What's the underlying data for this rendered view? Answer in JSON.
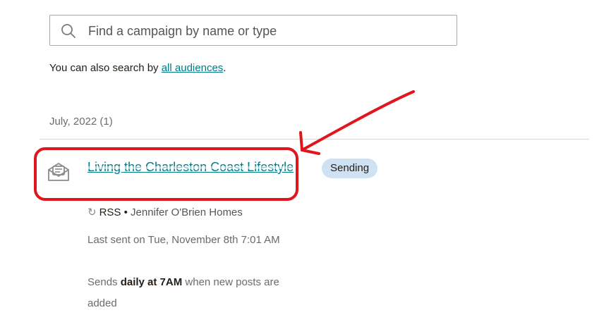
{
  "search": {
    "placeholder": "Find a campaign by name or type",
    "icon": "search-icon"
  },
  "helper": {
    "prefix": "You can also search by ",
    "link": "all audiences",
    "suffix": "."
  },
  "group": {
    "month_label": "July, 2022 (1)"
  },
  "campaign": {
    "icon": "email-campaign-icon",
    "title": "Living the Charleston Coast Lifestyle",
    "status": "Sending",
    "type_icon": "refresh-icon",
    "type": "RSS",
    "separator": " • ",
    "author": "Jennifer O'Brien Homes",
    "last_sent": "Last sent on Tue, November 8th 7:01 AM",
    "sends_prefix": "Sends ",
    "sends_bold": "daily at 7AM",
    "sends_suffix": " when new posts are added"
  },
  "colors": {
    "accent_link": "#007c89",
    "badge_bg": "#cfe2f3",
    "annotation": "#e0161e"
  }
}
